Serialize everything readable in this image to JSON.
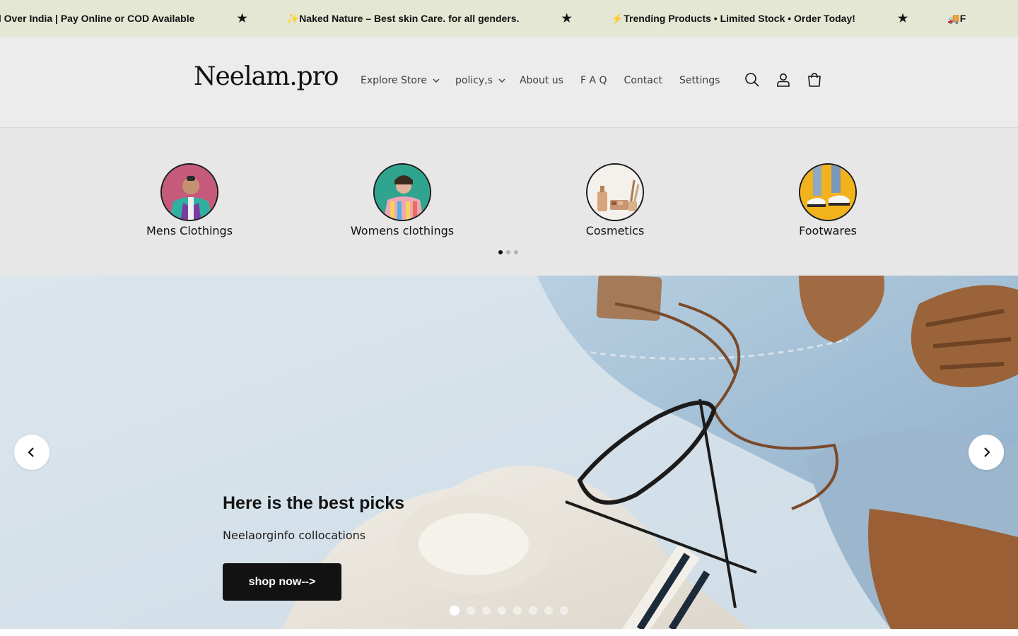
{
  "announcement": {
    "items": [
      "ll Over India | Pay Online or COD Available",
      "✨Naked Nature – Best skin Care. for all genders.",
      "⚡Trending Products • Limited Stock • Order Today!",
      "🚚F"
    ],
    "separator": "★"
  },
  "header": {
    "logo": "Neelam.pro",
    "nav": [
      {
        "label": "Explore Store",
        "has_dropdown": true
      },
      {
        "label": "policy,s",
        "has_dropdown": true
      },
      {
        "label": "About us",
        "has_dropdown": false
      },
      {
        "label": "F A Q",
        "has_dropdown": false
      },
      {
        "label": "Contact",
        "has_dropdown": false
      },
      {
        "label": "Settings",
        "has_dropdown": false
      }
    ],
    "icons": [
      "search-icon",
      "account-icon",
      "cart-icon"
    ]
  },
  "categories": {
    "items": [
      {
        "label": "Mens Clothings"
      },
      {
        "label": "Womens clothings"
      },
      {
        "label": "Cosmetics"
      },
      {
        "label": "Footwares"
      }
    ],
    "pagination": {
      "total": 3,
      "active": 1
    }
  },
  "hero": {
    "title": "Here is the best picks",
    "subtitle": "Neelaorginfo collocations",
    "button": "shop now-->",
    "pagination": {
      "total": 8,
      "active": 1
    }
  },
  "colors": {
    "announcement_bg": "#e3e7d3",
    "header_bg": "#ececec",
    "categories_bg": "#e7e7e7",
    "button_bg": "#121212"
  }
}
